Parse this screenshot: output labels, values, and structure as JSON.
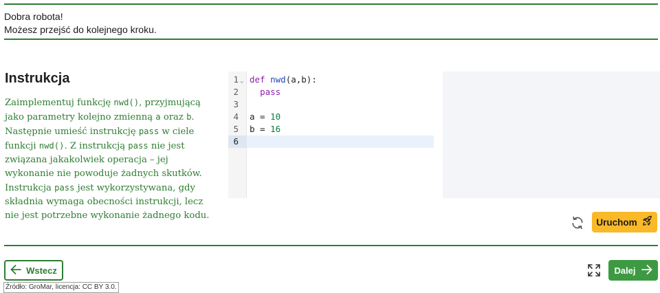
{
  "feedback": {
    "line1": "Dobra robota!",
    "line2": "Możesz przejść do kolejnego kroku."
  },
  "instruction": {
    "title": "Instrukcja",
    "parts": {
      "p1": "Zaimplementuj funkcję ",
      "c1": "nwd()",
      "p2": ", przyjmującą jako parametry kolejno zmienną ",
      "c2": "a",
      "p3": " oraz ",
      "c3": "b",
      "p4": ". Następnie umieść instrukcję ",
      "c4": "pass",
      "p5": " w ciele funkcji ",
      "c5": "nwd()",
      "p6": ". Z instrukcją ",
      "c6": "pass",
      "p7": " nie jest związana jakakolwiek operacja – jej wykonanie nie powoduje żadnych skutków. Instrukcja ",
      "c7": "pass",
      "p8": " jest wykorzystywana, gdy składnia wymaga obecności instrukcji, lecz nie jest potrzebne wykonanie żadnego kodu."
    }
  },
  "editor": {
    "line_numbers": [
      "1",
      "2",
      "3",
      "4",
      "5",
      "6"
    ],
    "active_line": 6,
    "code": {
      "l1_kw": "def",
      "l1_fn": "nwd",
      "l1_rest": "(a,b):",
      "l2_kw": "pass",
      "l4_var": "a = ",
      "l4_num": "10",
      "l5_var": "b = ",
      "l5_num": "16"
    }
  },
  "actions": {
    "run_label": "Uruchom",
    "back_label": "Wstecz",
    "next_label": "Dalej"
  },
  "source": "Źródło: GroMar, licencja: CC BY 3.0.",
  "icons": {
    "refresh": "refresh-icon",
    "run": "rocket-icon",
    "back": "arrow-left-icon",
    "next": "arrow-right-icon",
    "fullscreen": "fullscreen-icon",
    "fold": "chevron-down-icon"
  },
  "colors": {
    "accent_green": "#2e7d32",
    "next_button": "#3d9a42",
    "run_button": "#f9b928",
    "output_bg": "#f3f5f9"
  }
}
